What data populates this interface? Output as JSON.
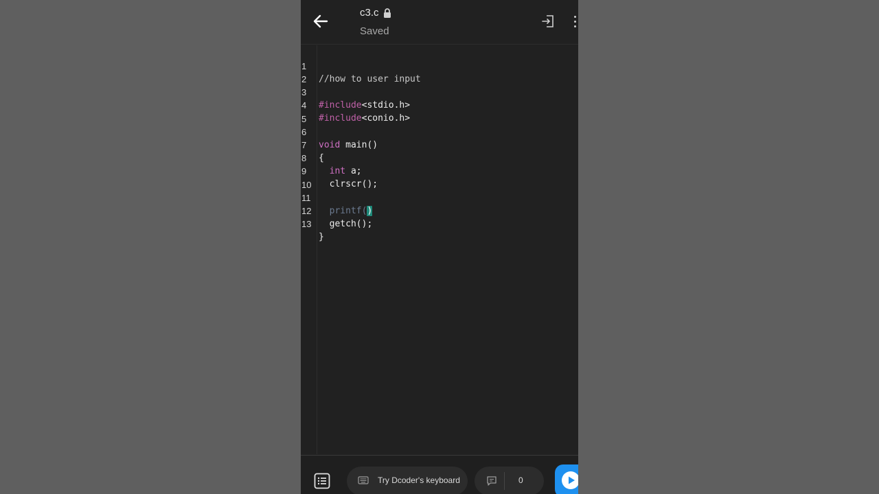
{
  "header": {
    "file_name": "c3.c",
    "status": "Saved",
    "icons": {
      "back": "arrow-left-icon",
      "lock": "lock-icon",
      "exit": "exit-icon",
      "more": "more-vertical-icon"
    }
  },
  "editor": {
    "line_numbers": [
      "1",
      "2",
      "3",
      "4",
      "5",
      "6",
      "7",
      "8",
      "9",
      "10",
      "11",
      "12",
      "13"
    ],
    "lines": {
      "l1": "//how to user input",
      "l3_pre": "#include",
      "l3_rest": "<stdio.h>",
      "l4_pre": "#include",
      "l4_rest": "<conio.h>",
      "l6_kw": "void",
      "l6_rest": " main()",
      "l7": "{",
      "l8_indent": "  ",
      "l8_kw": "int",
      "l8_rest": " a;",
      "l9": "  clrscr();",
      "l11_indent": "  ",
      "l11_fn": "printf(",
      "l11_cursor": ")",
      "l12": "  getch();",
      "l13": "}"
    }
  },
  "bottom": {
    "keyboard_label": "Try Dcoder's keyboard",
    "comment_count": "0",
    "icons": {
      "list": "list-icon",
      "keyboard": "keyboard-icon",
      "comment": "comment-icon",
      "run": "play-icon"
    }
  },
  "colors": {
    "background": "#212121",
    "preprocessor": "#c061a8",
    "keyword": "#d070c4",
    "accent": "#1e90ef",
    "cursor_highlight": "#1f8a7a"
  }
}
